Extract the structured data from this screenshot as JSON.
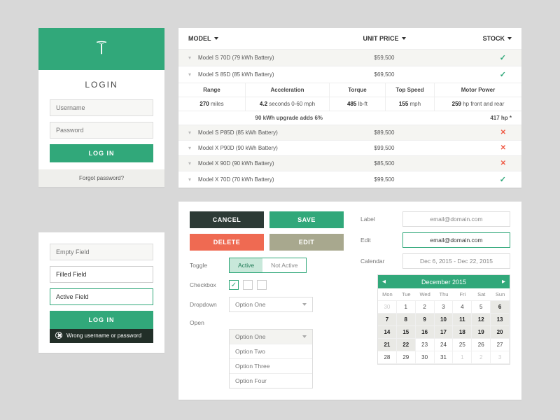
{
  "login": {
    "title": "LOGIN",
    "username_ph": "Username",
    "password_ph": "Password",
    "submit": "LOG IN",
    "forgot": "Forgot password?"
  },
  "states": {
    "empty_ph": "Empty Field",
    "filled_val": "Filled Field",
    "active_val": "Active Field",
    "submit": "LOG IN",
    "error": "Wrong username or password"
  },
  "table": {
    "headers": {
      "model": "MODEL",
      "price": "UNIT PRICE",
      "stock": "STOCK"
    },
    "rows": [
      {
        "model": "Model S 70D (79 kWh Battery)",
        "price": "$59,500",
        "stock": "check"
      },
      {
        "model": "Model S 85D (85 kWh Battery)",
        "price": "$69,500",
        "stock": "check"
      }
    ],
    "specs_headers": {
      "range": "Range",
      "accel": "Acceleration",
      "torque": "Torque",
      "top": "Top Speed",
      "motor": "Motor Power"
    },
    "specs_values": {
      "range_v": "270",
      "range_u": "miles",
      "accel_v": "4.2",
      "accel_u": "seconds 0-60 mph",
      "torque_v": "485",
      "torque_u": "lb-ft",
      "top_v": "155",
      "top_u": "mph",
      "motor_v": "259",
      "motor_u": "hp front and rear"
    },
    "upgrade": {
      "label": "90 kWh upgrade adds 6%",
      "motor": "417 hp *"
    },
    "rows2": [
      {
        "model": "Model S P85D (85 kWh Battery)",
        "price": "$89,500",
        "stock": "cross"
      },
      {
        "model": "Model X P90D (90 kWh Battery)",
        "price": "$99,500",
        "stock": "cross"
      },
      {
        "model": "Model X 90D (90 kWh Battery)",
        "price": "$85,500",
        "stock": "cross"
      },
      {
        "model": "Model X 70D (70 kWh Battery)",
        "price": "$99,500",
        "stock": "check"
      }
    ]
  },
  "form": {
    "buttons": {
      "cancel": "CANCEL",
      "save": "SAVE",
      "delete": "DELETE",
      "edit": "EDIT"
    },
    "labels": {
      "toggle": "Toggle",
      "checkbox": "Checkbox",
      "dropdown": "Dropdown",
      "open": "Open",
      "label": "Label",
      "edit": "Edit",
      "calendar": "Calendar"
    },
    "toggle": {
      "on": "Active",
      "off": "Not Active"
    },
    "dropdown_value": "Option One",
    "open_options": [
      "Option One",
      "Option Two",
      "Option Three",
      "Option Four"
    ],
    "label_value": "email@domain.com",
    "edit_value": "email@domain.com",
    "calendar_range": "Dec 6, 2015 - Dec 22, 2015"
  },
  "calendar": {
    "title": "December 2015",
    "dow": [
      "Mon",
      "Tue",
      "Wed",
      "Thu",
      "Fri",
      "Sat",
      "Sun"
    ],
    "days": [
      {
        "n": 30,
        "m": true
      },
      {
        "n": 1
      },
      {
        "n": 2
      },
      {
        "n": 3
      },
      {
        "n": 4
      },
      {
        "n": 5
      },
      {
        "n": 6,
        "s": true
      },
      {
        "n": 7,
        "s": true
      },
      {
        "n": 8,
        "s": true
      },
      {
        "n": 9,
        "s": true
      },
      {
        "n": 10,
        "s": true
      },
      {
        "n": 11,
        "s": true
      },
      {
        "n": 12,
        "s": true
      },
      {
        "n": 13,
        "s": true
      },
      {
        "n": 14,
        "s": true
      },
      {
        "n": 15,
        "s": true
      },
      {
        "n": 16,
        "s": true
      },
      {
        "n": 17,
        "s": true
      },
      {
        "n": 18,
        "s": true
      },
      {
        "n": 19,
        "s": true
      },
      {
        "n": 20,
        "s": true
      },
      {
        "n": 21,
        "s": true
      },
      {
        "n": 22,
        "s": true
      },
      {
        "n": 23
      },
      {
        "n": 24
      },
      {
        "n": 25
      },
      {
        "n": 26
      },
      {
        "n": 27
      },
      {
        "n": 28
      },
      {
        "n": 29
      },
      {
        "n": 30
      },
      {
        "n": 31
      },
      {
        "n": 1,
        "m": true
      },
      {
        "n": 2,
        "m": true
      },
      {
        "n": 3,
        "m": true
      }
    ]
  }
}
